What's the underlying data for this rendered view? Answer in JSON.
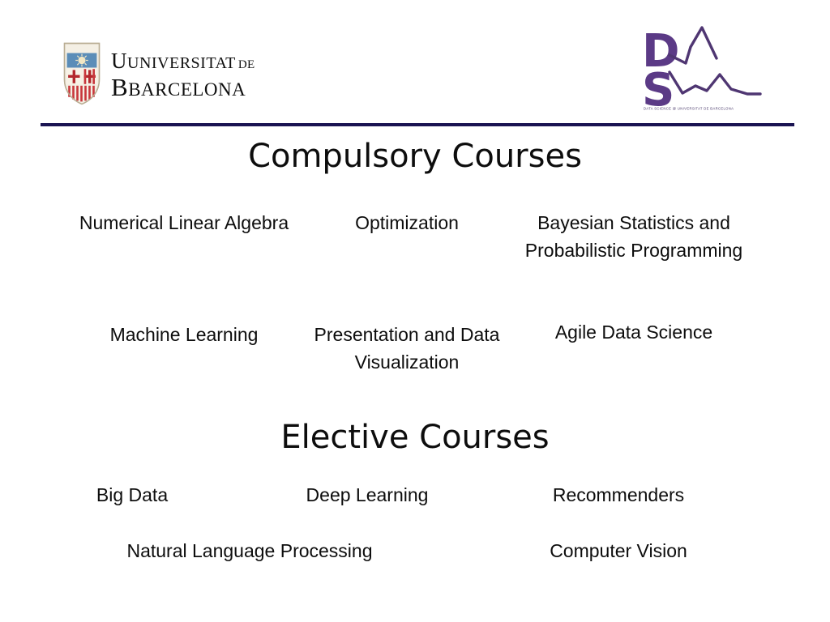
{
  "header": {
    "university_logo": {
      "name": "universitat-de-barcelona-logo",
      "line1": "UNIVERSITAT",
      "line1_suffix": "DE",
      "line2": "BARCELONA"
    },
    "program_logo": {
      "name": "data-science-ds-logo",
      "letter_d": "D",
      "letter_s": "S",
      "caption": "DATA SCIENCE @ UNIVERSITAT DE BARCELONA",
      "color": "#5b3a86"
    },
    "divider_color": "#1a1452"
  },
  "sections": [
    {
      "title": "Compulsory Courses",
      "rows": [
        [
          "Numerical Linear Algebra",
          "Optimization",
          "Bayesian Statistics and Probabilistic Programming"
        ],
        [
          "Machine Learning",
          "Presentation and Data Visualization",
          "Agile Data Science"
        ]
      ]
    },
    {
      "title": "Elective Courses",
      "rows": [
        [
          "Big Data",
          "Deep Learning",
          "Recommenders"
        ],
        [
          "Natural Language Processing",
          "Computer Vision"
        ]
      ]
    }
  ]
}
